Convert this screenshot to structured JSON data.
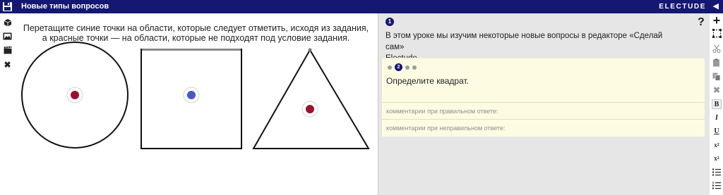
{
  "header": {
    "title": "Новые типы вопросов",
    "brand": "ELECTUDE",
    "collapse_glyph": "◀",
    "save_icon": "save-icon",
    "background": "#151872"
  },
  "left_toolbar": {
    "icons": [
      "cube-icon",
      "image-icon",
      "clapperboard-icon",
      "close-icon"
    ],
    "close_glyph": "✖"
  },
  "stage": {
    "instruction_line1": "Перетащите синие точки на области, которые следует отметить, исходя из задания,",
    "instruction_line2": "а красные точки — на области, которые не подходят под условие задания.",
    "shapes": [
      "circle",
      "square",
      "triangle"
    ],
    "marker_colors": {
      "red": "#9b1230",
      "blue": "#4a55c8"
    }
  },
  "panel": {
    "step_number": "1",
    "intro_line1": "В этом уроке мы изучим некоторые новые вопросы в редакторе «Сделай сам»",
    "intro_line2": "Electude.",
    "card": {
      "active_step": "2",
      "question": "Определите квадрат.",
      "correct_feedback_placeholder": "комментарии при правильном ответе:",
      "incorrect_feedback_placeholder": "комментарии при неправильном ответе:",
      "background": "#fdfce3"
    }
  },
  "right_toolbar": {
    "help": "?",
    "add": "+",
    "delete": "✖",
    "bold": "B",
    "italic": "I",
    "underline": "U",
    "superscript_base": "x",
    "superscript_mark": "2",
    "subscript_base": "x",
    "subscript_mark": "2"
  }
}
